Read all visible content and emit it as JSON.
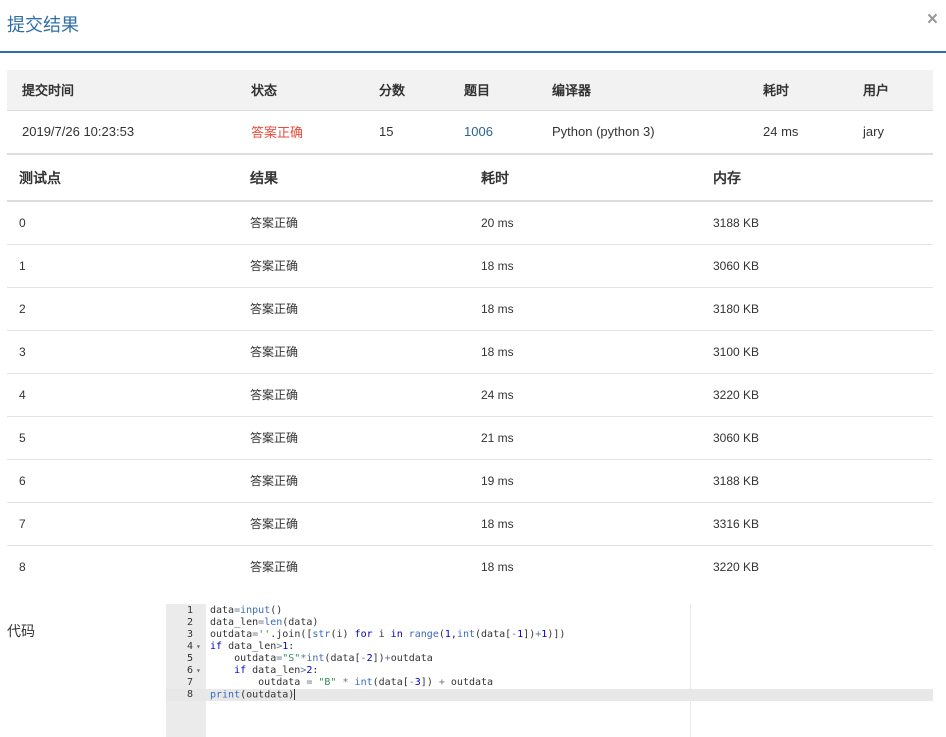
{
  "modal": {
    "title": "提交结果",
    "close_label": "×"
  },
  "summary": {
    "headers": {
      "time": "提交时间",
      "status": "状态",
      "score": "分数",
      "problem": "题目",
      "compiler": "编译器",
      "elapsed": "耗时",
      "user": "用户"
    },
    "row": {
      "time": "2019/7/26 10:23:53",
      "status": "答案正确",
      "score": "15",
      "problem": "1006",
      "compiler": "Python (python 3)",
      "elapsed": "24 ms",
      "user": "jary"
    }
  },
  "cases": {
    "headers": {
      "case": "测试点",
      "result": "结果",
      "time": "耗时",
      "memory": "内存"
    },
    "rows": [
      {
        "case": "0",
        "result": "答案正确",
        "time": "20 ms",
        "memory": "3188 KB"
      },
      {
        "case": "1",
        "result": "答案正确",
        "time": "18 ms",
        "memory": "3060 KB"
      },
      {
        "case": "2",
        "result": "答案正确",
        "time": "18 ms",
        "memory": "3180 KB"
      },
      {
        "case": "3",
        "result": "答案正确",
        "time": "18 ms",
        "memory": "3100 KB"
      },
      {
        "case": "4",
        "result": "答案正确",
        "time": "24 ms",
        "memory": "3220 KB"
      },
      {
        "case": "5",
        "result": "答案正确",
        "time": "21 ms",
        "memory": "3060 KB"
      },
      {
        "case": "6",
        "result": "答案正确",
        "time": "19 ms",
        "memory": "3188 KB"
      },
      {
        "case": "7",
        "result": "答案正确",
        "time": "18 ms",
        "memory": "3316 KB"
      },
      {
        "case": "8",
        "result": "答案正确",
        "time": "18 ms",
        "memory": "3220 KB"
      }
    ]
  },
  "code": {
    "label": "代码",
    "lines": [
      {
        "number": "1",
        "text": "data=input()",
        "fold": ""
      },
      {
        "number": "2",
        "text": "data_len=len(data)",
        "fold": ""
      },
      {
        "number": "3",
        "text": "outdata=''.join([str(i) for i in range(1,int(data[-1])+1)])",
        "fold": ""
      },
      {
        "number": "4",
        "text": "if data_len>1:",
        "fold": "▾"
      },
      {
        "number": "5",
        "text": "    outdata=\"S\"*int(data[-2])+outdata",
        "fold": ""
      },
      {
        "number": "6",
        "text": "    if data_len>2:",
        "fold": "▾"
      },
      {
        "number": "7",
        "text": "        outdata = \"B\" * int(data[-3]) + outdata",
        "fold": ""
      },
      {
        "number": "8",
        "text": "print(outdata)",
        "fold": ""
      }
    ],
    "active_line": 8
  },
  "colors": {
    "accent": "#2f6fa7",
    "accepted": "#e74c3c",
    "link": "#2a6496"
  }
}
